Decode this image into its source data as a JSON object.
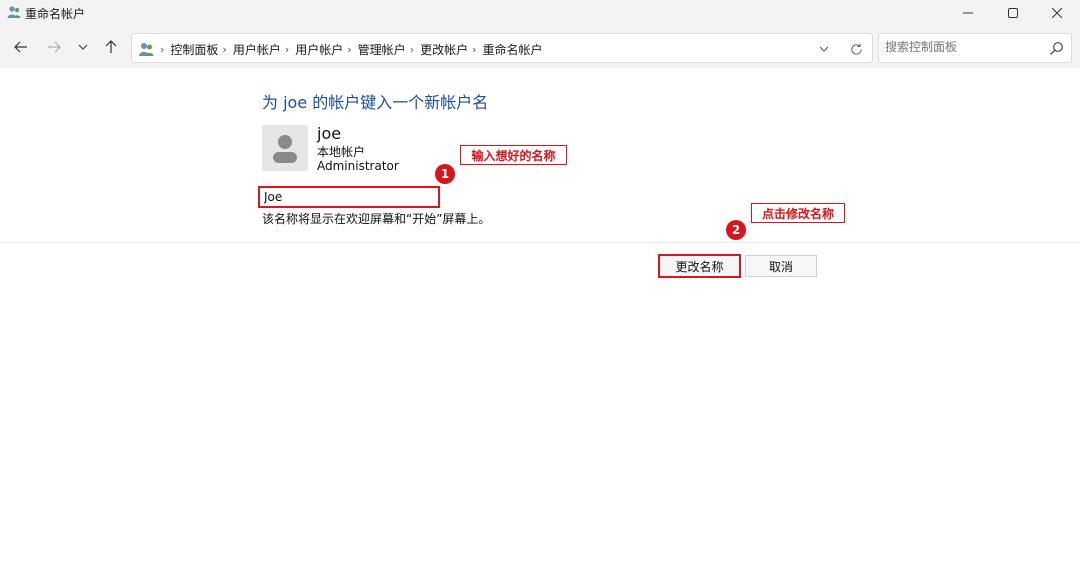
{
  "window": {
    "title": "重命名帐户",
    "minimize_icon": "minimize-icon",
    "maximize_icon": "maximize-icon",
    "close_icon": "close-icon"
  },
  "nav": {
    "breadcrumbs": [
      "控制面板",
      "用户帐户",
      "用户帐户",
      "管理帐户",
      "更改帐户",
      "重命名帐户"
    ],
    "search_placeholder": "搜索控制面板"
  },
  "content": {
    "heading": "为 joe 的帐户键入一个新帐户名",
    "user": {
      "name": "joe",
      "type": "本地帐户",
      "role": "Administrator"
    },
    "new_name_value": "Joe",
    "hint": "该名称将显示在欢迎屏幕和“开始”屏幕上。",
    "rename_button": "更改名称",
    "cancel_button": "取消"
  },
  "annotations": {
    "step1_number": "1",
    "step1_note": "输入想好的名称",
    "step2_number": "2",
    "step2_note": "点击修改名称",
    "color": "#e0141e"
  },
  "colors": {
    "heading": "#1e4e9c",
    "chrome": "#f3f3f3"
  }
}
